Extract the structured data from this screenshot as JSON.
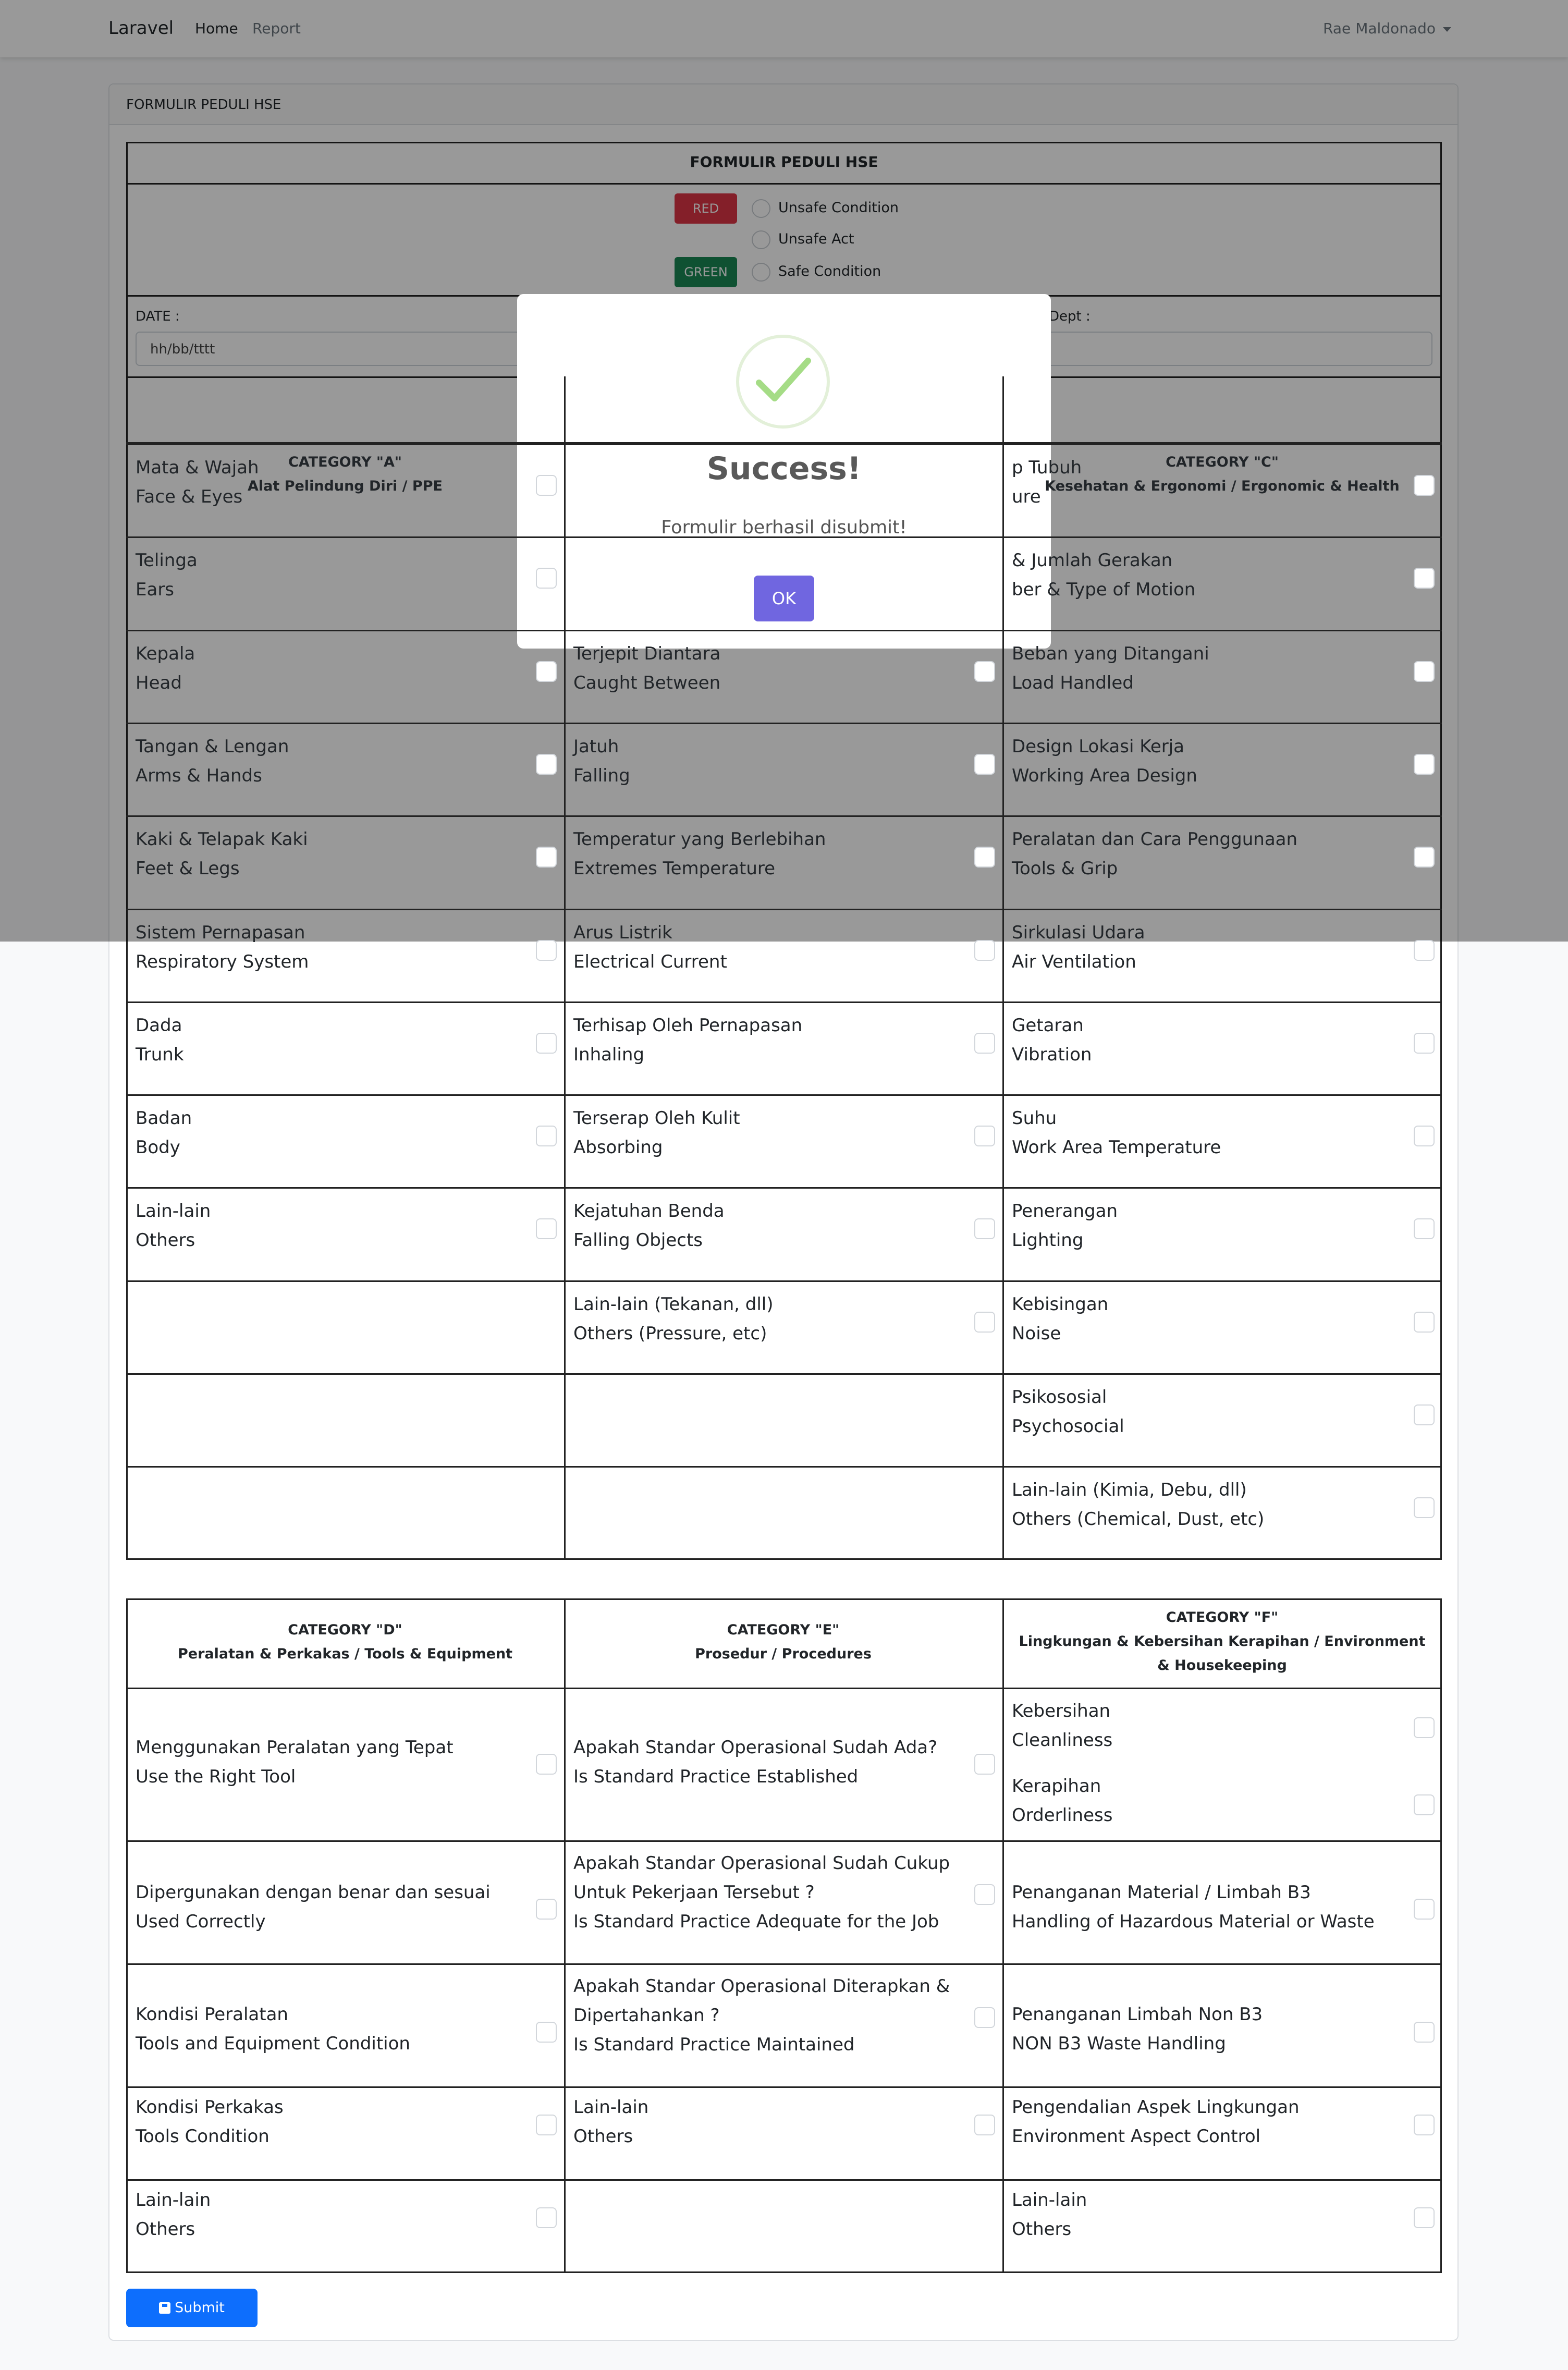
{
  "navbar": {
    "brand": "Laravel",
    "home": "Home",
    "report": "Report",
    "user": "Rae Maldonado"
  },
  "card": {
    "header": "FORMULIR PEDULI HSE"
  },
  "form": {
    "title": "FORMULIR PEDULI HSE",
    "badge_red": "RED",
    "badge_green": "GREEN",
    "colors": {
      "red": "#dc3545",
      "green": "#198754",
      "primary": "#0d6efd",
      "ok": "#7066e0",
      "success_check": "#a5dc86"
    },
    "radios": [
      "Unsafe Condition",
      "Unsafe Act",
      "Safe Condition"
    ],
    "date_label": "DATE :",
    "date_placeholder": "hh/bb/tttt",
    "dept_label": "Dept :"
  },
  "table1": {
    "headers": [
      {
        "title": "CATEGORY \"A\"",
        "sub": "Alat Pelindung Diri / PPE"
      },
      {
        "title": "",
        "sub": ""
      },
      {
        "title": "CATEGORY \"C\"",
        "sub": "Kesehatan & Ergonomi / Ergonomic & Health"
      }
    ],
    "col_a": [
      [
        "Mata & Wajah",
        "Face & Eyes"
      ],
      [
        "Telinga",
        "Ears"
      ],
      [
        "Kepala",
        "Head"
      ],
      [
        "Tangan & Lengan",
        "Arms & Hands"
      ],
      [
        "Kaki & Telapak Kaki",
        "Feet & Legs"
      ],
      [
        "Sistem Pernapasan",
        "Respiratory System"
      ],
      [
        "Dada",
        "Trunk"
      ],
      [
        "Badan",
        "Body"
      ],
      [
        "Lain-lain",
        "Others"
      ]
    ],
    "col_b": [
      [
        "Terjepit Diantara",
        "Caught Between"
      ],
      [
        "Jatuh",
        "Falling"
      ],
      [
        "Temperatur yang Berlebihan",
        "Extremes Temperature"
      ],
      [
        "Arus Listrik",
        "Electrical Current"
      ],
      [
        "Terhisap Oleh Pernapasan",
        "Inhaling"
      ],
      [
        "Terserap Oleh Kulit",
        "Absorbing"
      ],
      [
        "Kejatuhan Benda",
        "Falling Objects"
      ],
      [
        "Lain-lain (Tekanan, dll)",
        "Others (Pressure, etc)"
      ]
    ],
    "col_c": [
      [
        "p Tubuh",
        "ure"
      ],
      [
        " & Jumlah Gerakan",
        "ber & Type of Motion"
      ],
      [
        "Beban yang Ditangani",
        "Load Handled"
      ],
      [
        "Design Lokasi Kerja",
        "Working Area Design"
      ],
      [
        "Peralatan dan Cara Penggunaan",
        "Tools & Grip"
      ],
      [
        "Sirkulasi Udara",
        "Air Ventilation"
      ],
      [
        "Getaran",
        "Vibration"
      ],
      [
        "Suhu",
        "Work Area Temperature"
      ],
      [
        "Penerangan",
        "Lighting"
      ],
      [
        "Kebisingan",
        "Noise"
      ],
      [
        "Psikososial",
        "Psychosocial"
      ],
      [
        "Lain-lain (Kimia, Debu, dll)",
        "Others (Chemical, Dust, etc)"
      ]
    ]
  },
  "table2": {
    "headers": [
      {
        "title": "CATEGORY \"D\"",
        "sub": "Peralatan & Perkakas / Tools & Equipment"
      },
      {
        "title": "CATEGORY \"E\"",
        "sub": "Prosedur / Procedures"
      },
      {
        "title": "CATEGORY \"F\"",
        "sub": "Lingkungan & Kebersihan Kerapihan / Environment & Housekeeping"
      }
    ],
    "col_d": [
      [
        "Menggunakan Peralatan yang Tepat",
        "Use the Right Tool"
      ],
      [
        "Dipergunakan dengan benar dan sesuai",
        "Used Correctly"
      ],
      [
        "Kondisi Peralatan",
        "Tools and Equipment Condition"
      ],
      [
        "Kondisi Perkakas",
        "Tools Condition"
      ],
      [
        "Lain-lain",
        "Others"
      ]
    ],
    "col_e": [
      [
        "Apakah Standar Operasional Sudah Ada?",
        "Is Standard Practice Established"
      ],
      [
        "Apakah Standar Operasional Sudah Cukup",
        "Untuk Pekerjaan Tersebut ?",
        "Is Standard Practice Adequate for the Job"
      ],
      [
        "Apakah Standar Operasional Diterapkan &",
        "Dipertahankan ?",
        "Is Standard Practice Maintained"
      ],
      [
        "Lain-lain",
        "Others"
      ]
    ],
    "col_f": [
      [
        "Kebersihan",
        "Cleanliness"
      ],
      [
        "Kerapihan",
        "Orderliness"
      ],
      [
        "Penanganan Material / Limbah B3",
        "Handling of Hazardous Material or Waste"
      ],
      [
        "Penanganan Limbah Non B3",
        "NON B3 Waste Handling"
      ],
      [
        "Pengendalian Aspek Lingkungan",
        "Environment Aspect Control"
      ],
      [
        "Lain-lain",
        "Others"
      ]
    ]
  },
  "submit": "Submit",
  "modal": {
    "title": "Success!",
    "text": "Formulir berhasil disubmit!",
    "ok": "OK",
    "icon": "success-check-icon"
  }
}
